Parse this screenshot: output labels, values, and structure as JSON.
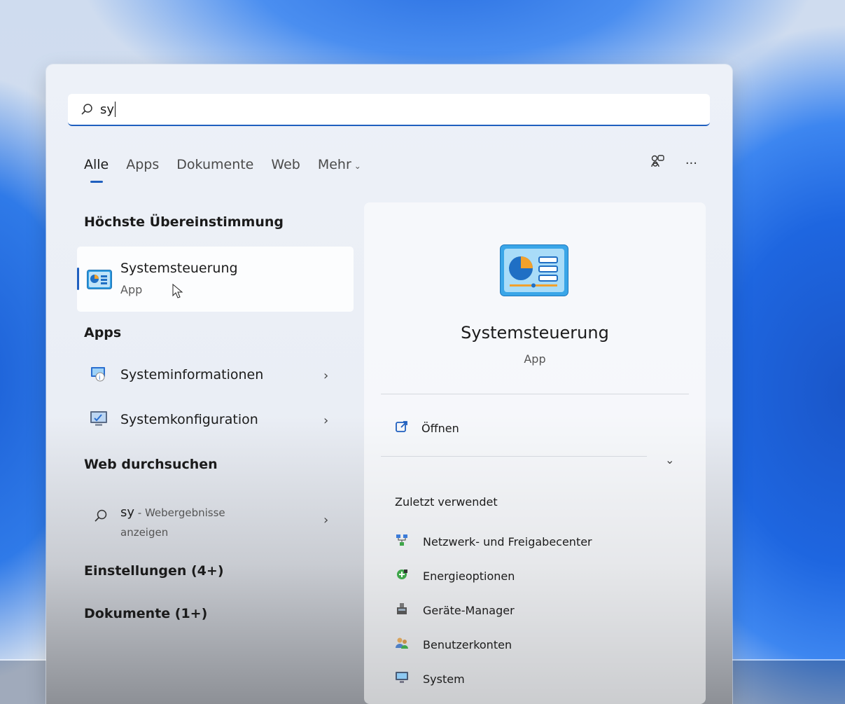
{
  "search": {
    "query": "sy"
  },
  "tabs": [
    {
      "label": "Alle",
      "active": true
    },
    {
      "label": "Apps"
    },
    {
      "label": "Dokumente"
    },
    {
      "label": "Web"
    },
    {
      "label": "Mehr"
    }
  ],
  "top_icons": [
    "share-account-icon",
    "more-options-icon"
  ],
  "left": {
    "best_match_title": "Höchste Übereinstimmung",
    "best_match": {
      "name": "Systemsteuerung",
      "type": "App",
      "icon": "control-panel-icon"
    },
    "apps_title": "Apps",
    "apps": [
      {
        "name": "Systeminformationen",
        "icon": "system-info-icon"
      },
      {
        "name": "Systemkonfiguration",
        "icon": "system-config-icon"
      }
    ],
    "web_title": "Web durchsuchen",
    "web": {
      "query": "sy",
      "suffix": " - Webergebnisse anzeigen"
    },
    "settings_title": "Einstellungen (4+)",
    "documents_title": "Dokumente (1+)"
  },
  "right": {
    "app_name": "Systemsteuerung",
    "app_type": "App",
    "open_label": "Öffnen",
    "recent_title": "Zuletzt verwendet",
    "recent": [
      {
        "label": "Netzwerk- und Freigabecenter",
        "icon": "network-icon"
      },
      {
        "label": "Energieoptionen",
        "icon": "power-options-icon"
      },
      {
        "label": "Geräte-Manager",
        "icon": "device-manager-icon"
      },
      {
        "label": "Benutzerkonten",
        "icon": "user-accounts-icon"
      },
      {
        "label": "System",
        "icon": "system-icon"
      }
    ]
  },
  "colors": {
    "accent": "#1f5fbf"
  }
}
